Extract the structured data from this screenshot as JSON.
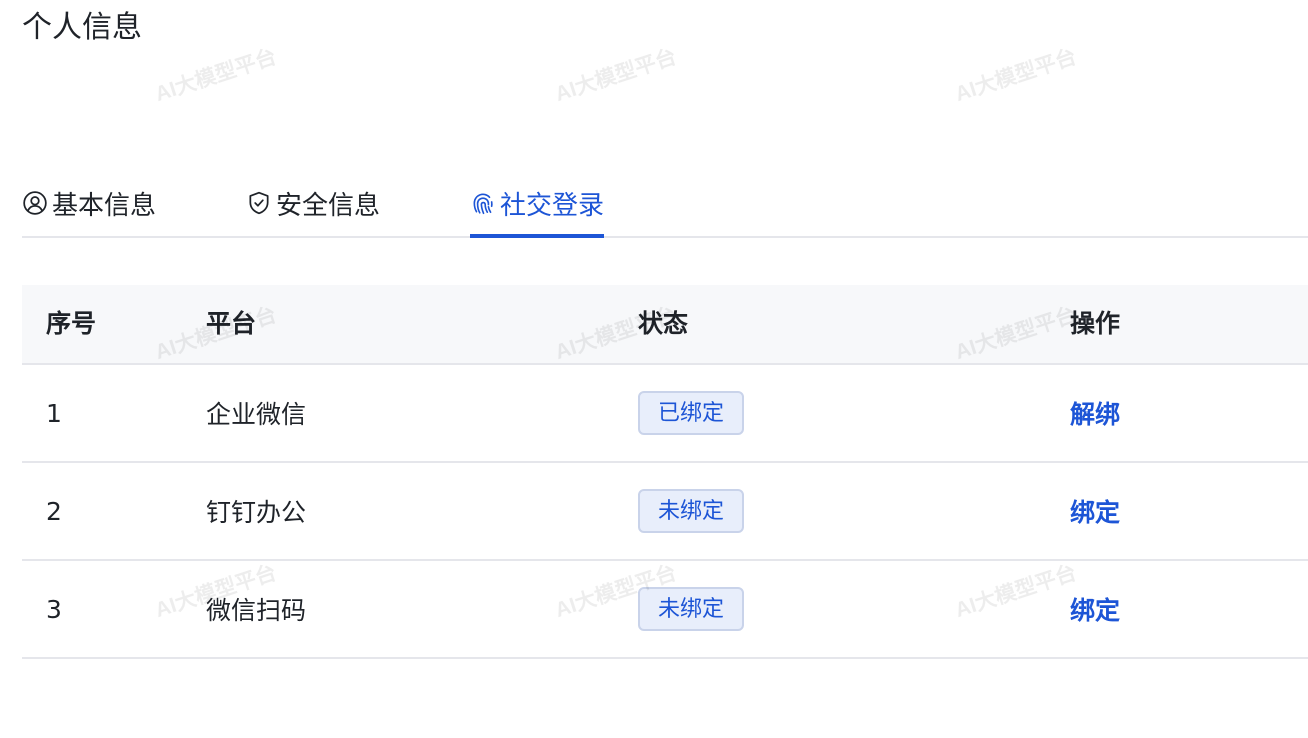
{
  "page": {
    "title": "个人信息"
  },
  "watermark": {
    "text": "AI大模型平台"
  },
  "tabs": [
    {
      "label": "基本信息",
      "icon": "user-circle-icon",
      "active": false
    },
    {
      "label": "安全信息",
      "icon": "shield-check-icon",
      "active": false
    },
    {
      "label": "社交登录",
      "icon": "fingerprint-icon",
      "active": true
    }
  ],
  "table": {
    "columns": [
      "序号",
      "平台",
      "状态",
      "操作"
    ],
    "rows": [
      {
        "index": "1",
        "platform": "企业微信",
        "status": "已绑定",
        "action": "解绑"
      },
      {
        "index": "2",
        "platform": "钉钉办公",
        "status": "未绑定",
        "action": "绑定"
      },
      {
        "index": "3",
        "platform": "微信扫码",
        "status": "未绑定",
        "action": "绑定"
      }
    ]
  },
  "colors": {
    "accent": "#1d55d6",
    "badge_bg": "#e8eefb",
    "header_bg": "#f7f8fa",
    "divider": "#e5e6eb"
  }
}
